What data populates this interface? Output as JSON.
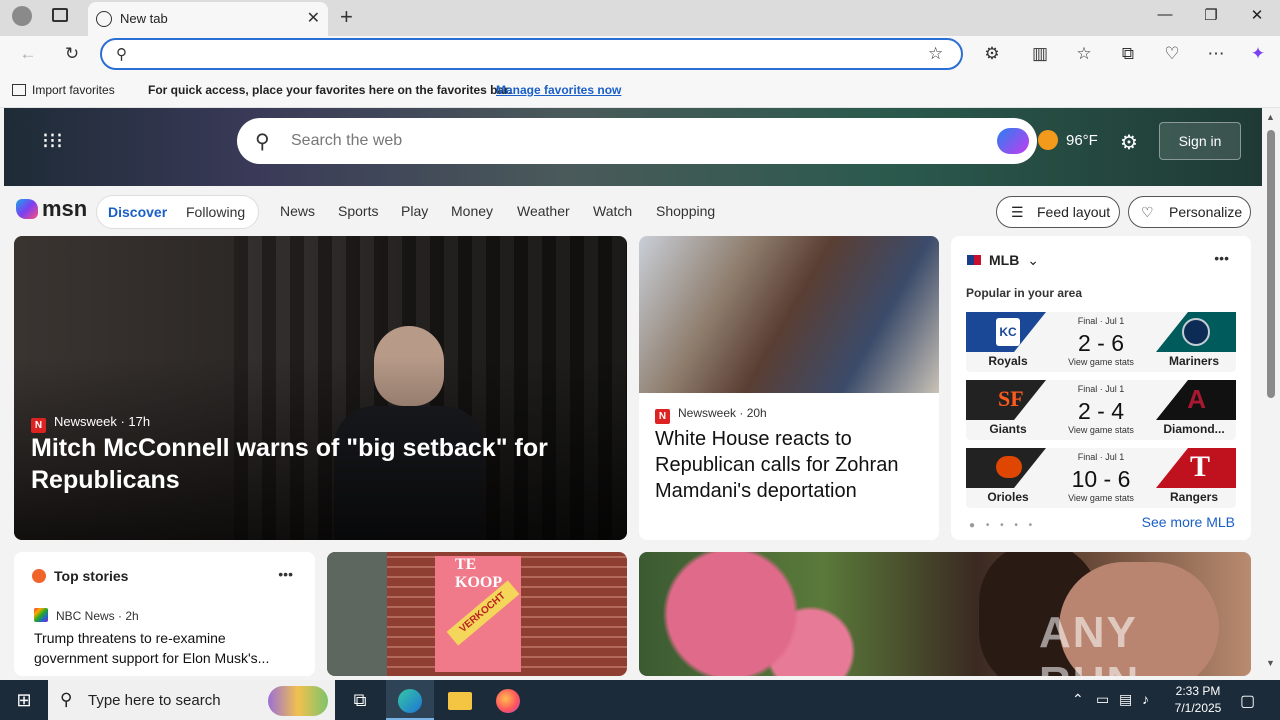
{
  "browser": {
    "tab_title": "New tab",
    "favorites_bar": {
      "import_label": "Import favorites",
      "message": "For quick access, place your favorites here on the favorites bar.",
      "manage_link": "Manage favorites now"
    }
  },
  "header": {
    "search_placeholder": "Search the web",
    "weather_temp": "96°F",
    "sign_in": "Sign in"
  },
  "nav": {
    "logo_text": "msn",
    "discover": "Discover",
    "following": "Following",
    "items": [
      "News",
      "Sports",
      "Play",
      "Money",
      "Weather",
      "Watch",
      "Shopping"
    ],
    "feed_layout": "Feed layout",
    "personalize": "Personalize"
  },
  "feature": {
    "source": "Newsweek",
    "time": "· 17h",
    "headline": "Mitch McConnell warns of \"big setback\" for Republicans"
  },
  "mid_story": {
    "source": "Newsweek",
    "time": "· 20h",
    "headline": "White House reacts to Republican calls for Zohran Mamdani's deportation"
  },
  "mlb": {
    "title": "MLB",
    "popular": "Popular in your area",
    "games": [
      {
        "status": "Final · Jul 1",
        "home": "Royals",
        "away": "Mariners",
        "score": "2 - 6",
        "stats": "View game stats",
        "home_color": "#1a4796",
        "away_color": "#005c5c"
      },
      {
        "status": "Final · Jul 1",
        "home": "Giants",
        "away": "Diamond...",
        "score": "2 - 4",
        "stats": "View game stats",
        "home_color": "#222222",
        "away_color": "#111111"
      },
      {
        "status": "Final · Jul 1",
        "home": "Orioles",
        "away": "Rangers",
        "score": "10 - 6",
        "stats": "View game stats",
        "home_color": "#222222",
        "away_color": "#c0111f"
      }
    ],
    "see_more": "See more MLB"
  },
  "top_stories": {
    "title": "Top stories",
    "source": "NBC News",
    "time": "· 2h",
    "headline": "Trump threatens to re-examine government support for Elon Musk's..."
  },
  "image_card": {
    "sign_text": "TE KOOP",
    "band_text": "VERKOCHT"
  },
  "watermark": "ANY RUN",
  "taskbar": {
    "search_placeholder": "Type here to search",
    "time": "2:33 PM",
    "date": "7/1/2025"
  }
}
